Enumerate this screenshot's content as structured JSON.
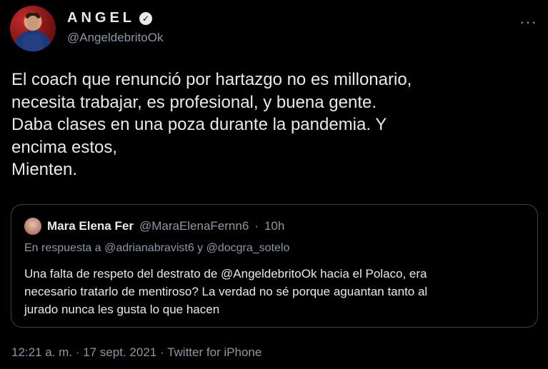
{
  "author": {
    "display_name": "ANGEL",
    "verified_mark": "✓",
    "handle": "@AngeldebritoOk"
  },
  "more_icon": "···",
  "tweet_lines": [
    "El coach que renunció por hartazgo no es millonario,",
    "necesita trabajar, es profesional, y buena gente.",
    "Daba clases en una poza durante la pandemia. Y",
    "encima estos,",
    "Mienten."
  ],
  "quoted_tweet": {
    "name": "Mara Elena Fer",
    "handle": "@MaraElenaFernn6",
    "separator": "·",
    "time": "10h",
    "reply_context": "En respuesta a @adrianabravist6 y @docgra_sotelo",
    "text_lines": [
      "Una falta de respeto del destrato de @AngeldebritoOk hacia el Polaco, era",
      "necesario tratarlo de mentiroso? La verdad no sé porque aguantan tanto al",
      "jurado nunca les gusta lo que hacen"
    ]
  },
  "meta": {
    "time": "12:21 a. m.",
    "date": "17 sept. 2021",
    "source": "Twitter for iPhone",
    "separator": "·"
  }
}
